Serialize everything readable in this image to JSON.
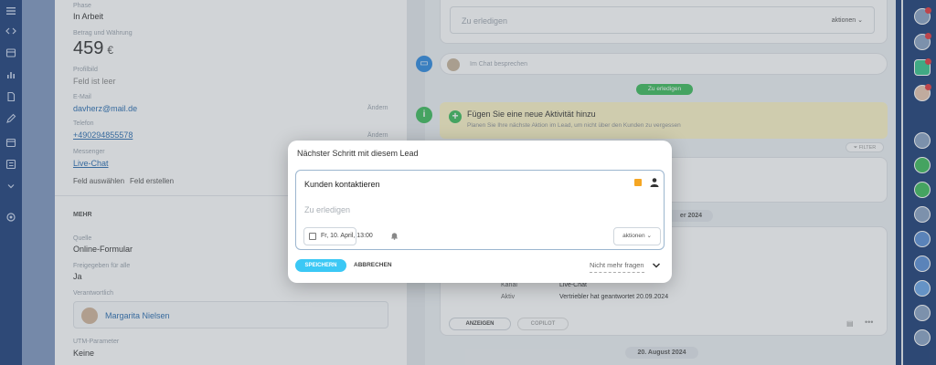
{
  "left_panel": {
    "phase_label": "Phase",
    "phase_value": "In Arbeit",
    "amount_label": "Betrag und Währung",
    "amount_value": "459",
    "currency": "€",
    "profile_label": "Profilbild",
    "profile_value": "Feld ist leer",
    "email_label": "E-Mail",
    "email_value": "davherz@mail.de",
    "email_change": "Ändern",
    "phone_label": "Telefon",
    "phone_value": "+490294855578",
    "phone_change": "Ändern",
    "messenger_label": "Messenger",
    "messenger_value": "Live-Chat",
    "select_field": "Feld auswählen",
    "create_field": "Feld erstellen",
    "more_header": "MEHR",
    "source_label": "Quelle",
    "source_value": "Online-Formular",
    "shared_label": "Freigegeben für alle",
    "shared_value": "Ja",
    "responsible_label": "Verantwortlich",
    "responsible_name": "Margarita Nielsen",
    "utm_label": "UTM-Parameter",
    "utm_value": "Keine"
  },
  "right_panel": {
    "todo_placeholder": "Zu erledigen",
    "todo_actions": "aktionen",
    "chat_placeholder": "Im Chat besprechen",
    "todo_badge": "Zu erledigen",
    "new_activity_title": "Fügen Sie eine neue Aktivität hinzu",
    "new_activity_sub": "Planen Sie Ihre nächste Aktion im Lead, um nicht über den Kunden zu vergessen",
    "filter_label": "FILTER",
    "date_partial": "er 2024",
    "channel_label": "Kanal",
    "channel_value": "Live-Chat",
    "active_label": "Aktiv",
    "active_value": "Vertriebler hat geantwortet 20.09.2024",
    "show_button": "ANZEIGEN",
    "copilot_button": "COPILOT",
    "date_pill": "20. August 2024"
  },
  "modal": {
    "title": "Nächster Schritt mit diesem Lead",
    "task_title": "Kunden kontaktieren",
    "desc_placeholder": "Zu erledigen",
    "deadline": "Fr, 10. April, 13:00",
    "actions_label": "aktionen",
    "save_label": "SPEICHERN",
    "cancel_label": "ABBRECHEN",
    "dont_ask_label": "Nicht mehr fragen"
  },
  "colors": {
    "nav_bg": "#1e3f7a",
    "save_blue": "#3bc8f5",
    "green": "#3dbb5c",
    "yellow_card": "#fdf4c7",
    "link": "#2a6db0",
    "notification": "#e4383d"
  }
}
